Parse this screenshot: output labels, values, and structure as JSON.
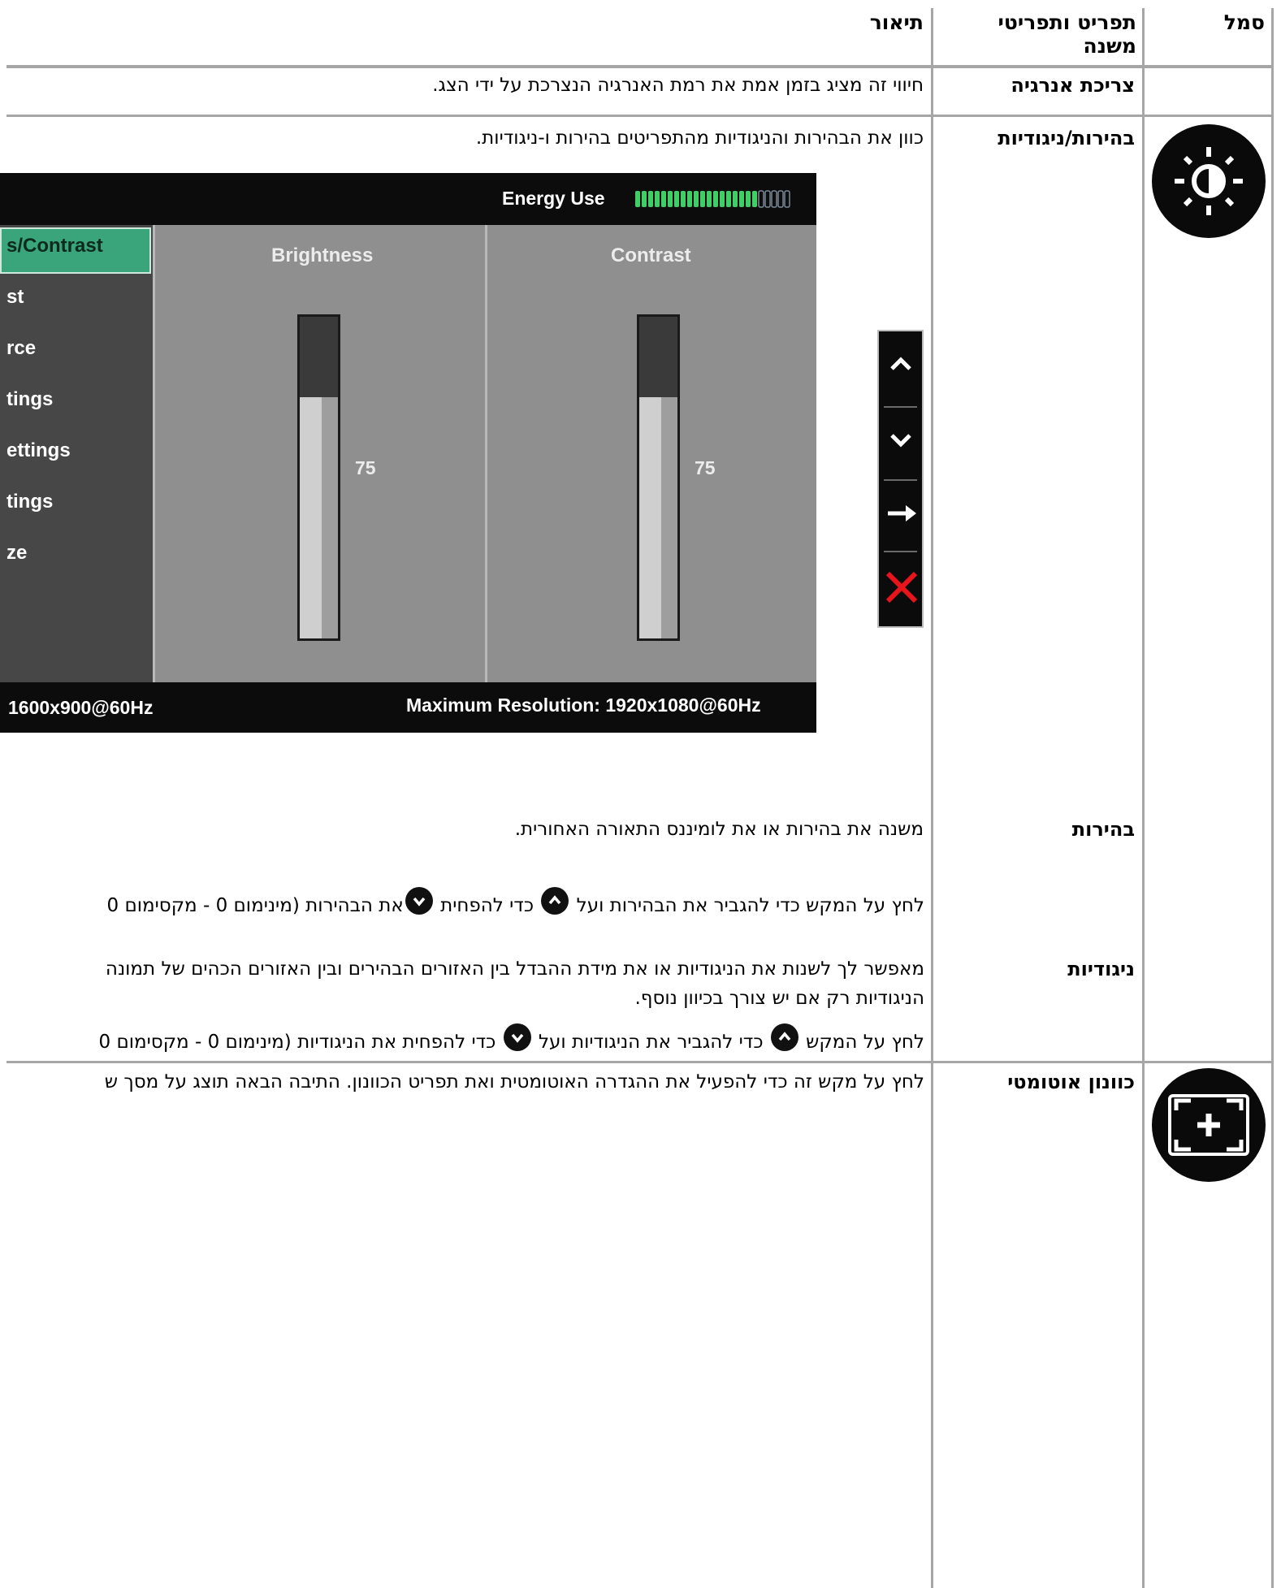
{
  "table": {
    "headers": {
      "icon": "סמל",
      "menu": "תפריט ותפריטי משנה",
      "description": "תיאור"
    },
    "rows": {
      "energy": {
        "item": "צריכת אנרגיה",
        "desc": "חיווי זה מציג בזמן אמת את רמת האנרגיה הנצרכת על ידי הצג."
      },
      "brightness_contrast": {
        "icon": "brightness-contrast-icon",
        "item": "בהירות/ניגודיות",
        "desc": "כוון את הבהירות והניגודיות מהתפריטים בהירות ו-ניגודיות."
      },
      "brightness": {
        "item": "בהירות",
        "desc1": "משנה את בהירות או את לומיננס התאורה האחורית.",
        "desc2_a": "לחץ על המקש כדי להגביר את הבהירות ועל",
        "desc2_b": "כדי להפחית",
        "desc2_c": "את הבהירות (מינימום 0 - מקסימום 0"
      },
      "contrast": {
        "item": "ניגודיות",
        "desc1": "מאפשר לך לשנות את הניגודיות או את מידת ההבדל בין האזורים הבהירים ובין האזורים הכהים של תמונה",
        "desc2": "הניגודיות רק אם יש צורך בכיוון נוסף.",
        "desc3_a": "לחץ על המקש",
        "desc3_b": "כדי להגביר את הניגודיות ועל",
        "desc3_c": "כדי להפחית את הניגודיות (מינימום 0 - מקסימום 0"
      },
      "auto_adjust": {
        "icon": "auto-adjust-icon",
        "item": "כוונון אוטומטי",
        "desc": "לחץ על מקש זה כדי להפעיל את ההגדרה האוטומטית ואת תפריט הכוונון. התיבה הבאה תוצג על מסך ש"
      }
    }
  },
  "osd": {
    "energy_label": "Energy Use",
    "energy_level": 0.79,
    "menu_items": [
      "s/Contrast",
      "st",
      "rce",
      "tings",
      "ettings",
      "tings",
      "ze"
    ],
    "selected_index": 0,
    "brightness": {
      "label": "Brightness",
      "value": "75"
    },
    "contrast": {
      "label": "Contrast",
      "value": "75"
    },
    "current_resolution": "1600x900@60Hz",
    "max_resolution": "Maximum Resolution: 1920x1080@60Hz"
  },
  "nav_buttons": [
    "up-icon",
    "down-icon",
    "right-arrow-icon",
    "close-icon"
  ],
  "colors": {
    "osd_selected": "#3aa57a",
    "close_red": "#e8141c",
    "energy_bar": "#3fcf64"
  }
}
